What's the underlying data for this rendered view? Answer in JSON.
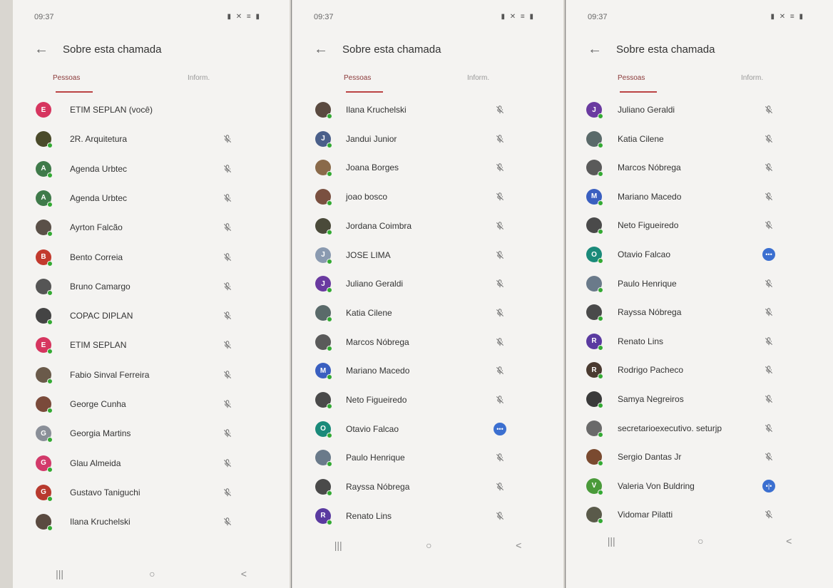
{
  "status_time": "09:37",
  "title": "Sobre esta chamada",
  "tab_people": "Pessoas",
  "tab_info": "Inform.",
  "nav": {
    "recents": "|||",
    "home": "○",
    "back": "<"
  },
  "phones": [
    {
      "people": [
        {
          "name": "ETIM SEPLAN (você)",
          "initial": "E",
          "color": "#d6355f",
          "mic": "none"
        },
        {
          "name": "2R. Arquitetura",
          "initial": "",
          "color": "#4a4a2a",
          "mic": "muted"
        },
        {
          "name": "Agenda Urbtec",
          "initial": "A",
          "color": "#3f7a4a",
          "mic": "muted"
        },
        {
          "name": "Agenda Urbtec",
          "initial": "A",
          "color": "#3f7a4a",
          "mic": "muted"
        },
        {
          "name": "Ayrton Falcão",
          "initial": "",
          "color": "#5a5048",
          "mic": "muted"
        },
        {
          "name": "Bento Correia",
          "initial": "B",
          "color": "#c23a2e",
          "mic": "muted"
        },
        {
          "name": "Bruno Camargo",
          "initial": "",
          "color": "#555",
          "mic": "muted"
        },
        {
          "name": "COPAC DIPLAN",
          "initial": "",
          "color": "#444",
          "mic": "muted"
        },
        {
          "name": "ETIM SEPLAN",
          "initial": "E",
          "color": "#d6355f",
          "mic": "muted"
        },
        {
          "name": "Fabio Sinval Ferreira",
          "initial": "",
          "color": "#6a5a4a",
          "mic": "muted"
        },
        {
          "name": "George Cunha",
          "initial": "",
          "color": "#7a4a3a",
          "mic": "muted"
        },
        {
          "name": "Georgia Martins",
          "initial": "G",
          "color": "#8a8f98",
          "mic": "muted"
        },
        {
          "name": "Glau Almeida",
          "initial": "G",
          "color": "#d23a6a",
          "mic": "muted"
        },
        {
          "name": "Gustavo Taniguchi",
          "initial": "G",
          "color": "#b83a2e",
          "mic": "muted"
        },
        {
          "name": "Ilana Kruchelski",
          "initial": "",
          "color": "#5a4a40",
          "mic": "muted"
        }
      ]
    },
    {
      "people": [
        {
          "name": "Ilana Kruchelski",
          "initial": "",
          "color": "#5a4a40",
          "mic": "muted"
        },
        {
          "name": "Jandui Junior",
          "initial": "J",
          "color": "#4a5f8a",
          "mic": "muted"
        },
        {
          "name": "Joana Borges",
          "initial": "",
          "color": "#8a6a4a",
          "mic": "muted"
        },
        {
          "name": "joao bosco",
          "initial": "",
          "color": "#7a5040",
          "mic": "muted"
        },
        {
          "name": "Jordana Coimbra",
          "initial": "",
          "color": "#4a4a3a",
          "mic": "muted"
        },
        {
          "name": "JOSE LIMA",
          "initial": "J",
          "color": "#8a9ab0",
          "mic": "muted"
        },
        {
          "name": "Juliano Geraldi",
          "initial": "J",
          "color": "#6a3aa0",
          "mic": "muted"
        },
        {
          "name": "Katia Cilene",
          "initial": "",
          "color": "#5a6a6a",
          "mic": "muted"
        },
        {
          "name": "Marcos Nóbrega",
          "initial": "",
          "color": "#5a5a5a",
          "mic": "muted"
        },
        {
          "name": "Mariano Macedo",
          "initial": "M",
          "color": "#3a5fc0",
          "mic": "muted"
        },
        {
          "name": "Neto Figueiredo",
          "initial": "",
          "color": "#4a4a4a",
          "mic": "muted"
        },
        {
          "name": "Otavio Falcao",
          "initial": "O",
          "color": "#1a8a7a",
          "mic": "more"
        },
        {
          "name": "Paulo Henrique",
          "initial": "",
          "color": "#6a7a8a",
          "mic": "muted"
        },
        {
          "name": "Rayssa Nóbrega",
          "initial": "",
          "color": "#4a4a4a",
          "mic": "muted"
        },
        {
          "name": "Renato Lins",
          "initial": "R",
          "color": "#5a3aa0",
          "mic": "muted"
        }
      ]
    },
    {
      "people": [
        {
          "name": "Juliano Geraldi",
          "initial": "J",
          "color": "#6a3aa0",
          "mic": "muted"
        },
        {
          "name": "Katia Cilene",
          "initial": "",
          "color": "#5a6a6a",
          "mic": "muted"
        },
        {
          "name": "Marcos Nóbrega",
          "initial": "",
          "color": "#5a5a5a",
          "mic": "muted"
        },
        {
          "name": "Mariano Macedo",
          "initial": "M",
          "color": "#3a5fc0",
          "mic": "muted"
        },
        {
          "name": "Neto Figueiredo",
          "initial": "",
          "color": "#4a4a4a",
          "mic": "muted"
        },
        {
          "name": "Otavio Falcao",
          "initial": "O",
          "color": "#1a8a7a",
          "mic": "more"
        },
        {
          "name": "Paulo Henrique",
          "initial": "",
          "color": "#6a7a8a",
          "mic": "muted"
        },
        {
          "name": "Rayssa Nóbrega",
          "initial": "",
          "color": "#4a4a4a",
          "mic": "muted"
        },
        {
          "name": "Renato Lins",
          "initial": "R",
          "color": "#5a3aa0",
          "mic": "muted"
        },
        {
          "name": "Rodrigo Pacheco",
          "initial": "R",
          "color": "#4a3a30",
          "mic": "muted"
        },
        {
          "name": "Samya Negreiros",
          "initial": "",
          "color": "#3a3a3a",
          "mic": "muted"
        },
        {
          "name": "secretarioexecutivo. seturjp",
          "initial": "",
          "color": "#6a6a6a",
          "mic": "muted"
        },
        {
          "name": "Sergio Dantas Jr",
          "initial": "",
          "color": "#7a4a30",
          "mic": "muted"
        },
        {
          "name": "Valeria Von Buldring",
          "initial": "V",
          "color": "#4a9a3a",
          "mic": "speaking"
        },
        {
          "name": "Vidomar Pilatti",
          "initial": "",
          "color": "#5a5a4a",
          "mic": "muted"
        }
      ]
    }
  ]
}
